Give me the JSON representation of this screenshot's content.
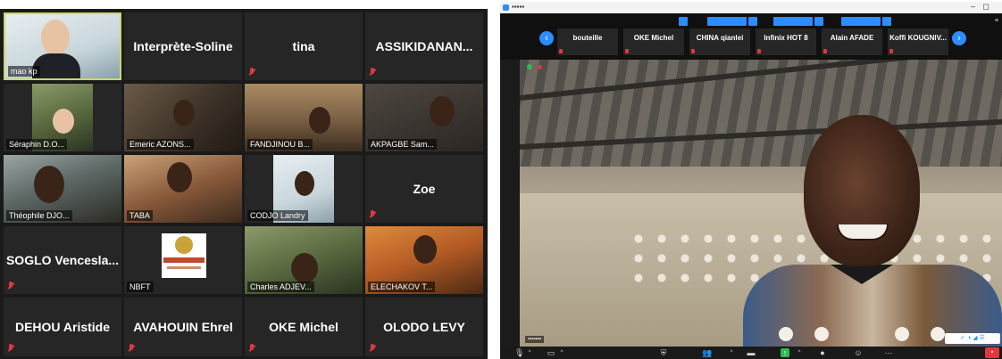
{
  "gallery": {
    "tiles": [
      {
        "label": "mao kp"
      },
      {
        "name": "Interprète-Soline"
      },
      {
        "name": "tina"
      },
      {
        "name": "ASSIKIDANAN..."
      },
      {
        "label": "Séraphin D.O..."
      },
      {
        "label": "Emeric AZONS..."
      },
      {
        "label": "FANDJINOU B..."
      },
      {
        "label": "AKPAGBE Sam..."
      },
      {
        "label": "Théophile DJO..."
      },
      {
        "label": "TABA"
      },
      {
        "label": "CODJO Landry"
      },
      {
        "name": "Zoe"
      },
      {
        "name": "SOGLO Vencesla..."
      },
      {
        "label": "NBFT"
      },
      {
        "label": "Charles ADJEV..."
      },
      {
        "label": "ELECHAKOV T..."
      },
      {
        "name": "DEHOU Aristide"
      },
      {
        "name": "AVAHOUIN Ehrel"
      },
      {
        "name": "OKE Michel"
      },
      {
        "name": "OLODO LEVY"
      }
    ]
  },
  "speaker": {
    "strip": {
      "prev_icon": "chevron-left-icon",
      "next_icon": "chevron-right-icon",
      "tiles": [
        {
          "name": "bouteille"
        },
        {
          "name": "OKE Michel"
        },
        {
          "name": "CHINA qianlei"
        },
        {
          "name": "Infinix HOT 8"
        },
        {
          "name": "Alain AFADE"
        },
        {
          "name": "Koffi KOUGNIV..."
        }
      ]
    }
  },
  "colors": {
    "accent": "#2d8cff",
    "mute_red": "#e0383e",
    "active_border": "#c9d86a",
    "record_green": "#2dba4e",
    "tile_bg": "#262626"
  }
}
